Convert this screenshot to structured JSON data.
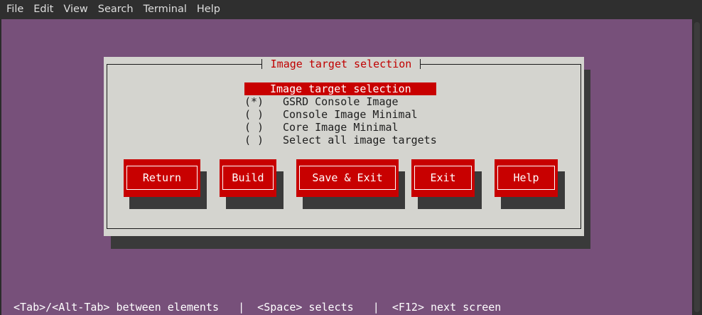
{
  "menu": [
    "File",
    "Edit",
    "View",
    "Search",
    "Terminal",
    "Help"
  ],
  "dialog": {
    "frame_title": "Image target selection",
    "list_header": "Image target selection",
    "items": [
      {
        "radio": "(*)",
        "label": "GSRD Console Image",
        "selected": true
      },
      {
        "radio": "( )",
        "label": "Console Image Minimal",
        "selected": false
      },
      {
        "radio": "( )",
        "label": "Core Image Minimal",
        "selected": false
      },
      {
        "radio": "( )",
        "label": "Select all image targets",
        "selected": false
      }
    ],
    "buttons": [
      "Return",
      "Build",
      "Save & Exit",
      "Exit",
      "Help"
    ]
  },
  "footer": "<Tab>/<Alt-Tab> between elements   |  <Space> selects   |  <F12> next screen",
  "colors": {
    "terminal_bg": "#77507a",
    "dialog_bg": "#d4d4cf",
    "accent_red": "#c80000",
    "shadow": "#3a3a3a"
  }
}
